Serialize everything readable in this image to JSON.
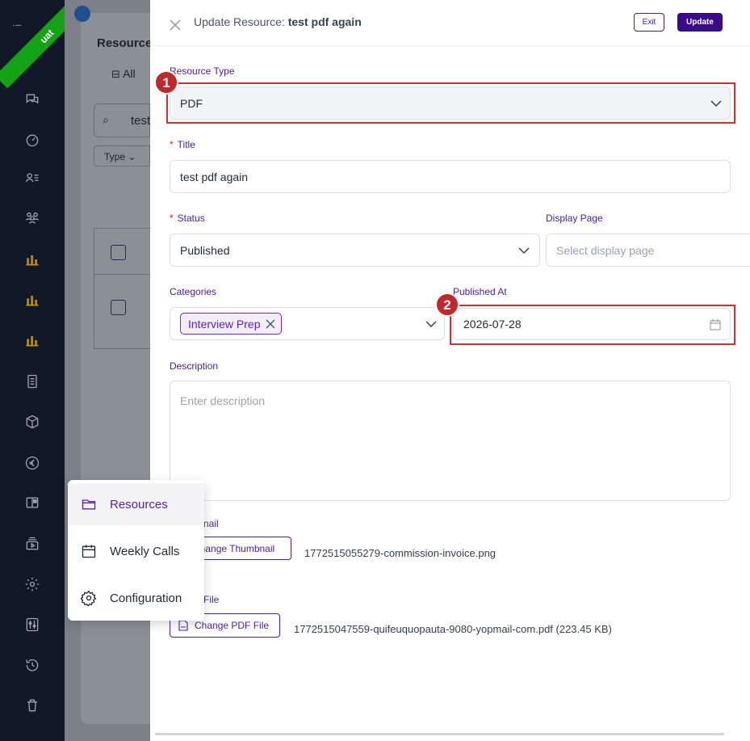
{
  "environment_badge": "uat",
  "background_page": {
    "heading": "Resource",
    "filter_all": "All",
    "search_value": "test",
    "type_filter": "Type"
  },
  "drawer": {
    "title_prefix": "Update Resource:",
    "title_name": "test pdf again",
    "exit_label": "Exit",
    "update_label": "Update",
    "resource_type": {
      "label": "Resource Type",
      "value": "PDF"
    },
    "title_field": {
      "label": "Title",
      "value": "test pdf again"
    },
    "status": {
      "label": "Status",
      "value": "Published"
    },
    "display_page": {
      "label": "Display Page",
      "placeholder": "Select display page"
    },
    "categories": {
      "label": "Categories",
      "tags": [
        "Interview Prep"
      ]
    },
    "published_at": {
      "label": "Published At",
      "value": "2026-07-28"
    },
    "description": {
      "label": "Description",
      "placeholder": "Enter description"
    },
    "thumbnail": {
      "label_visible": "nail",
      "button": "Change Thumbnail",
      "filename": "1772515055279-commission-invoice.png"
    },
    "pdf_file": {
      "label_visible": "File",
      "button": "Change PDF File",
      "filename": "1772515047559-quifeuquopauta-9080-yopmail-com.pdf (223.45 KB)"
    }
  },
  "annotations": {
    "marker_1": "1",
    "marker_2": "2",
    "highlight_color": "#d32f2f"
  },
  "popup_menu": {
    "items": [
      {
        "label": "Resources",
        "icon": "folder-icon",
        "active": true
      },
      {
        "label": "Weekly Calls",
        "icon": "calendar-icon",
        "active": false
      },
      {
        "label": "Configuration",
        "icon": "gear-icon",
        "active": false
      }
    ]
  },
  "sidebar_icons": [
    "chat-icon",
    "dashboard-icon",
    "user-list-icon",
    "users-icon",
    "bar-chart-icon",
    "bar-chart-icon",
    "bar-chart-icon",
    "document-icon",
    "cube-icon",
    "euro-icon",
    "book-icon",
    "media-icon",
    "gear-icon",
    "sliders-icon",
    "history-icon",
    "trash-icon"
  ],
  "colors": {
    "accent": "#4c1d95",
    "sidebar": "#111827",
    "ribbon": "#15a316"
  }
}
